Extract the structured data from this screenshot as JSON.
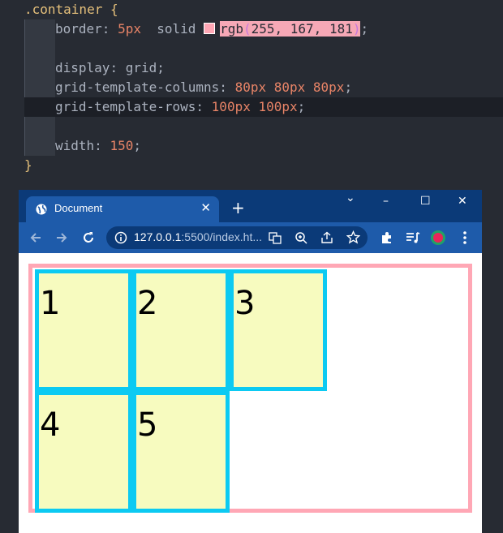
{
  "editor": {
    "selector": ".container",
    "open_brace": "{",
    "close_brace": "}",
    "declarations": [
      {
        "prop": "border",
        "colon": ":",
        "value1": "5px",
        "value2": "solid",
        "value3": "rgb",
        "paren_open": "(",
        "args": "255, 167, 181",
        "paren_close": ")",
        "semi": ";"
      },
      {
        "prop": "display",
        "colon": ":",
        "value": "grid",
        "semi": ";"
      },
      {
        "prop": "grid-template-columns",
        "colon": ":",
        "value": "80px 80px 80px",
        "semi": ";"
      },
      {
        "prop": "grid-template-rows",
        "colon": ":",
        "value": "100px 100px",
        "semi": ";"
      },
      {
        "prop": "width",
        "colon": ":",
        "value": "150",
        "semi": ";"
      }
    ],
    "swatch_color": "#ffa7b5"
  },
  "browser": {
    "tab_title": "Document",
    "tab_close": "✕",
    "new_tab": "+",
    "url_host": "127.0.0.1",
    "url_rest": ":5500/index.ht...",
    "window_controls": {
      "chevron": "⌄",
      "minimize": "–",
      "maximize": "☐",
      "close": "✕"
    },
    "icons": [
      "back-arrow-icon",
      "forward-arrow-icon",
      "reload-icon",
      "info-icon",
      "translate-icon",
      "zoom-icon",
      "share-icon",
      "bookmark-star-icon",
      "extensions-icon",
      "media-icon",
      "profile-icon",
      "menu-icon"
    ]
  },
  "grid": {
    "items": [
      "1",
      "2",
      "3",
      "4",
      "5"
    ],
    "container_border_color": "#ffa7b5",
    "item_border_color": "#0ccaf2",
    "item_bg_color": "#f7fbbf"
  }
}
